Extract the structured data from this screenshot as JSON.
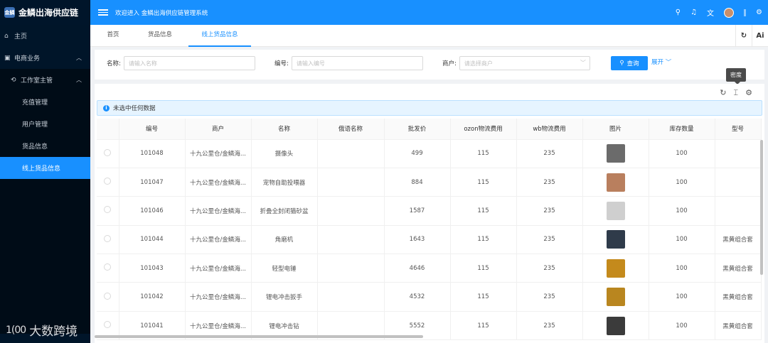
{
  "app": {
    "brand": "金鳞出海供应链",
    "brand_logo_text": "金鳞",
    "welcome": "欢迎进入 金鳞出海供应链管理系统"
  },
  "sidebar": {
    "items": [
      {
        "label": "主页",
        "icon": "home-icon"
      },
      {
        "label": "电商业务",
        "icon": "shop-icon"
      },
      {
        "label": "工作室主管",
        "icon": "studio-icon"
      },
      {
        "label": "充值管理"
      },
      {
        "label": "用户管理"
      },
      {
        "label": "货品信息"
      },
      {
        "label": "线上货品信息"
      }
    ],
    "watermark": "大数跨境",
    "watermark_logo": "1(00"
  },
  "topbar": {
    "icons": [
      "search-icon",
      "bell-icon",
      "translate-icon",
      "avatar",
      "settings-icon"
    ]
  },
  "tabs": [
    {
      "label": "首页"
    },
    {
      "label": "货品信息"
    },
    {
      "label": "线上货品信息"
    }
  ],
  "tab_tools": {
    "refresh": "↻",
    "ai": "Ai"
  },
  "search": {
    "name_label": "名称:",
    "name_placeholder": "请输入名称",
    "code_label": "编号:",
    "code_placeholder": "请输入编号",
    "merchant_label": "商户:",
    "merchant_placeholder": "请选择商户",
    "query_label": "查询",
    "expand_label": "展开"
  },
  "tooltip": "密度",
  "alert": "未选中任何数据",
  "table": {
    "columns": [
      "编号",
      "商户",
      "名称",
      "俄语名称",
      "批发价",
      "ozon物流费用",
      "wb物流费用",
      "图片",
      "库存数量",
      "型号"
    ],
    "rows": [
      {
        "code": "101048",
        "merchant": "十九公里仓/金鳞海...",
        "name": "摄像头",
        "ru_name": "",
        "price": "499",
        "ozon": "115",
        "wb": "235",
        "img": "#6b6b6b",
        "stock": "100",
        "model": ""
      },
      {
        "code": "101047",
        "merchant": "十九公里仓/金鳞海...",
        "name": "宠物自助投喂器",
        "ru_name": "",
        "price": "884",
        "ozon": "115",
        "wb": "235",
        "img": "#b97f5e",
        "stock": "100",
        "model": ""
      },
      {
        "code": "101046",
        "merchant": "十九公里仓/金鳞海...",
        "name": "折叠全封闭猫砂盆",
        "ru_name": "",
        "price": "1587",
        "ozon": "115",
        "wb": "235",
        "img": "#cfcfcf",
        "stock": "100",
        "model": ""
      },
      {
        "code": "101044",
        "merchant": "十九公里仓/金鳞海...",
        "name": "角磨机",
        "ru_name": "",
        "price": "1643",
        "ozon": "115",
        "wb": "235",
        "img": "#2f3b4a",
        "stock": "100",
        "model": "黑黄组合套"
      },
      {
        "code": "101043",
        "merchant": "十九公里仓/金鳞海...",
        "name": "轻型电锤",
        "ru_name": "",
        "price": "4646",
        "ozon": "115",
        "wb": "235",
        "img": "#c48a1c",
        "stock": "100",
        "model": "黑黄组合套"
      },
      {
        "code": "101042",
        "merchant": "十九公里仓/金鳞海...",
        "name": "锂电冲击扳手",
        "ru_name": "",
        "price": "4532",
        "ozon": "115",
        "wb": "235",
        "img": "#b9861f",
        "stock": "100",
        "model": "黑黄组合套"
      },
      {
        "code": "101041",
        "merchant": "十九公里仓/金鳞海...",
        "name": "锂电冲击钻",
        "ru_name": "",
        "price": "5552",
        "ozon": "115",
        "wb": "235",
        "img": "#3b3b3b",
        "stock": "100",
        "model": "黑黄组合套"
      }
    ]
  }
}
